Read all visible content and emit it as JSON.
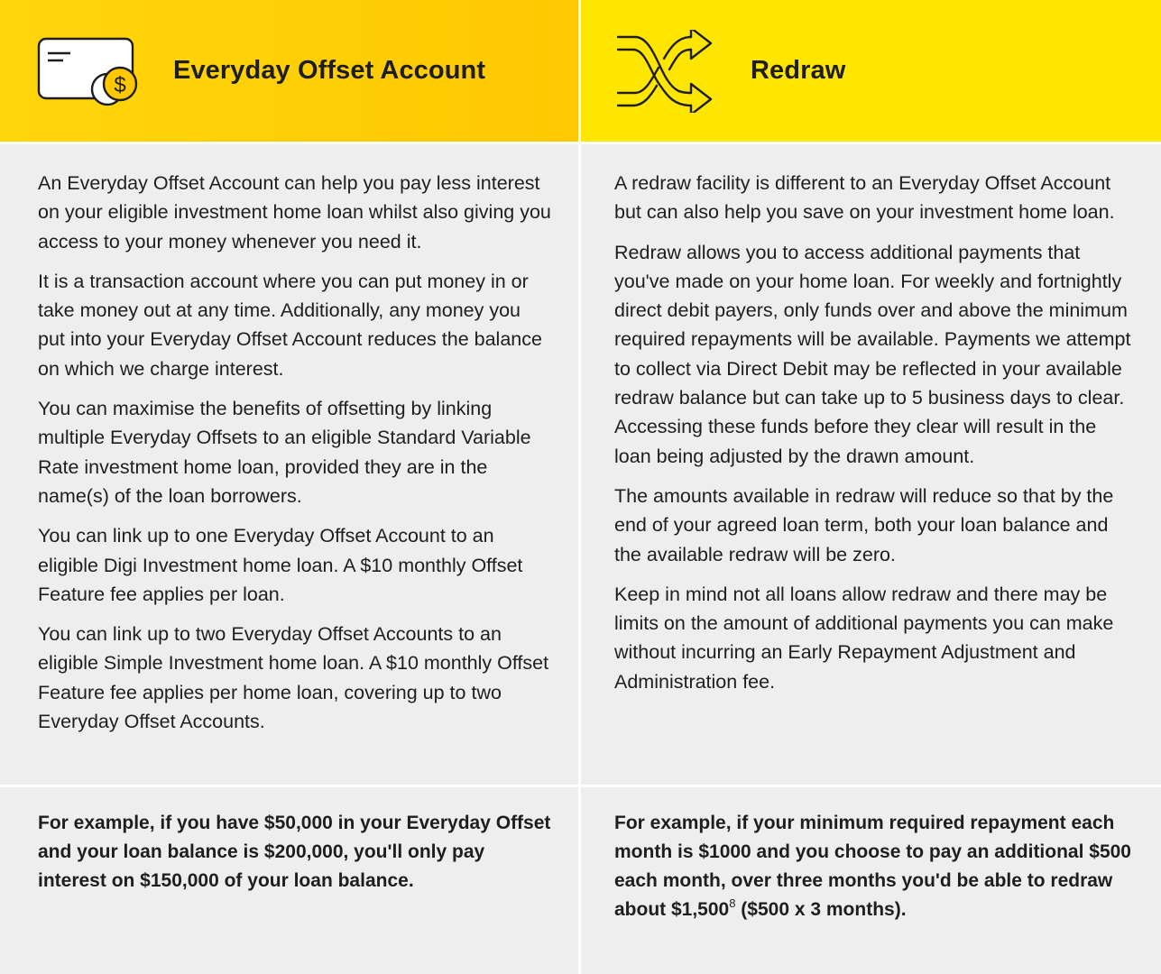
{
  "offset": {
    "title": "Everyday Offset Account",
    "icon": "card-coin-icon",
    "paragraphs": [
      "An Everyday Offset Account can help you pay less interest on your eligible investment home loan whilst also giving you access to your money whenever you need it.",
      "It is a transaction account where you can put money in or take money out at any time. Additionally, any money you put into your Everyday Offset Account reduces the balance on which we charge interest.",
      "You can maximise the benefits of offsetting by linking multiple Everyday Offsets to an eligible Standard Variable Rate investment home loan, provided they are in the name(s) of the loan borrowers.",
      "You can link up to one Everyday Offset Account to an eligible Digi Investment home loan. A $10 monthly Offset Feature fee applies per loan.",
      "You can link up to two Everyday Offset Accounts to an eligible Simple Investment home loan. A $10 monthly Offset Feature fee applies per home loan, covering up to two Everyday Offset Accounts."
    ],
    "example": "For example, if you have $50,000 in your Everyday Offset and your loan balance is $200,000, you'll only pay interest on $150,000 of your loan balance."
  },
  "redraw": {
    "title": "Redraw",
    "icon": "shuffle-arrows-icon",
    "paragraphs": [
      "A redraw facility is different to an Everyday Offset Account but can also help you save on your investment home loan.",
      "Redraw allows you to access additional payments that you've made on your home loan. For weekly and fortnightly direct debit payers, only funds over and above the minimum required repayments will be available. Payments we attempt to collect via Direct Debit may be reflected in your available redraw balance but can take up to 5 business days to clear. Accessing these funds before they clear will result in the loan being adjusted by the drawn amount.",
      "The amounts available in redraw will reduce so that by the end of your agreed loan term, both your loan balance and the available redraw will be zero.",
      "Keep in mind not all loans allow redraw and there may be limits on the amount of additional payments you can make without incurring an Early Repayment Adjustment and Administration fee."
    ],
    "example_before": "For example, if your minimum required repayment each month is $1000 and you choose to pay an additional $500 each month, over three months you'd be able to redraw about $1,500",
    "example_footnote": "8",
    "example_after": " ($500 x 3 months)."
  },
  "colors": {
    "header_left": "#ffc800",
    "header_right": "#ffe600",
    "panel": "#eeeeee",
    "text": "#1e1e1e"
  }
}
